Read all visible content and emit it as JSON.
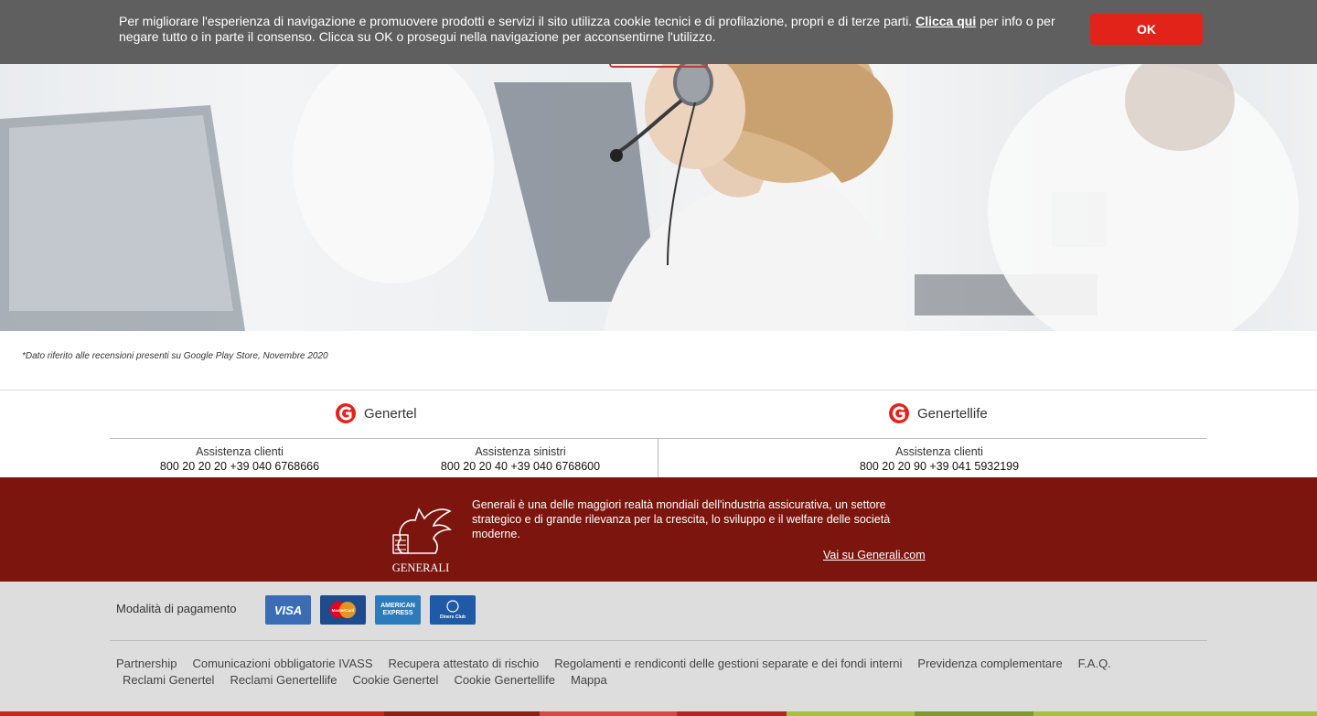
{
  "cookie": {
    "text_before": "Per migliorare l'esperienza di navigazione e promuovere prodotti e servizi il sito utilizza cookie tecnici e di profilazione, propri e di terze parti. ",
    "link_label": "Clicca qui",
    "text_after": " per info o per negare tutto o in parte il consenso. Clicca su OK o prosegui nella navigazione per acconsentirne l'utilizzo.",
    "ok_label": "OK"
  },
  "note": "*Dato riferito alle recensioni presenti su Google Play Store, Novembre 2020",
  "brands": {
    "genertel": {
      "name": "Genertel",
      "clienti_label": "Assistenza clienti",
      "clienti_nums": "800 20 20 20  +39 040 6768666",
      "sinistri_label": "Assistenza sinistri",
      "sinistri_nums": "800 20 20 40  +39 040 6768600"
    },
    "genertellife": {
      "name": "Genertellife",
      "clienti_label": "Assistenza clienti",
      "clienti_nums": "800 20 20 90  +39 041 5932199"
    }
  },
  "generali": {
    "logo_text": "GENERALI",
    "description": "Generali è una delle maggiori realtà mondiali dell'industria assicurativa, un settore strategico e di grande rilevanza per la crescita, lo sviluppo e il welfare delle società moderne.",
    "link": "Vai su Generali.com"
  },
  "footer": {
    "payment_label": "Modalità di pagamento",
    "cards": [
      "VISA",
      "MasterCard",
      "AMERICAN EXPRESS",
      "Diners Club"
    ],
    "links": [
      "Partnership",
      "Comunicazioni obbligatorie IVASS",
      "Recupera attestato di rischio",
      "Regolamenti e rendiconti delle gestioni separate e dei fondi interni",
      "Previdenza complementare",
      "F.A.Q.",
      "Reclami Genertel",
      "Reclami Genertellife",
      "Cookie Genertel",
      "Cookie Genertellife",
      "Mappa"
    ]
  },
  "colors": {
    "accent_red": "#e2231a",
    "generali_band": "#7c150d",
    "cookie_bg": "#5f5f5f",
    "footer_bg": "#dddddd"
  }
}
